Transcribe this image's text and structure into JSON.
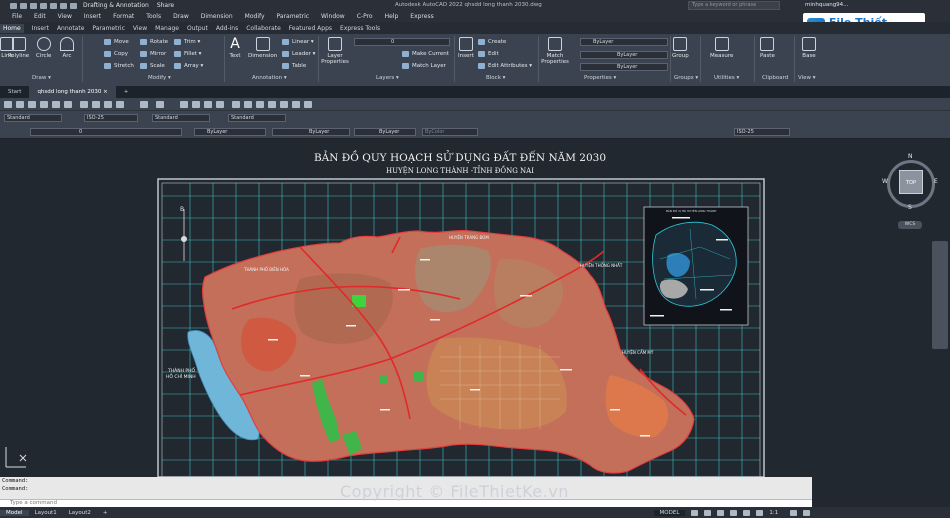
{
  "titlebar": {
    "workspace": "Drafting & Annotation",
    "share": "Share",
    "app_title": "Autodesk AutoCAD 2022    qhsdd long thanh 2030.dwg",
    "search_placeholder": "Type a keyword or phrase",
    "user": "minhquang94..."
  },
  "menu": [
    "File",
    "Edit",
    "View",
    "Insert",
    "Format",
    "Tools",
    "Draw",
    "Dimension",
    "Modify",
    "Parametric",
    "Window",
    "C-Pro",
    "Help",
    "Express"
  ],
  "ribbon_tabs": [
    "Home",
    "Insert",
    "Annotate",
    "Parametric",
    "View",
    "Manage",
    "Output",
    "Add-ins",
    "Collaborate",
    "Featured Apps",
    "Express Tools"
  ],
  "ribbon": {
    "draw": {
      "line": "Line",
      "polyline": "Polyline",
      "circle": "Circle",
      "arc": "Arc",
      "label": "Draw ▾"
    },
    "modify": {
      "move": "Move",
      "rotate": "Rotate",
      "trim": "Trim ▾",
      "copy": "Copy",
      "mirror": "Mirror",
      "fillet": "Fillet ▾",
      "stretch": "Stretch",
      "scale": "Scale",
      "array": "Array ▾",
      "label": "Modify ▾"
    },
    "annotation": {
      "text": "Text",
      "dimension": "Dimension",
      "linear": "Linear ▾",
      "leader": "Leader ▾",
      "table": "Table",
      "label": "Annotation ▾"
    },
    "layers": {
      "layer_properties": "Layer Properties",
      "current": "0",
      "make_current": "Make Current",
      "match_layer": "Match Layer",
      "label": "Layers ▾"
    },
    "block": {
      "insert": "Insert",
      "create": "Create",
      "edit": "Edit",
      "edit_attributes": "Edit Attributes ▾",
      "label": "Block ▾"
    },
    "properties": {
      "match": "Match Properties",
      "bylayer1": "ByLayer",
      "bylayer2": "ByLayer",
      "bylayer3": "ByLayer",
      "label": "Properties ▾"
    },
    "groups": {
      "group": "Group",
      "label": "Groups ▾"
    },
    "utilities": {
      "measure": "Measure",
      "label": "Utilities ▾"
    },
    "clipboard": {
      "paste": "Paste",
      "label": "Clipboard"
    },
    "view": {
      "base": "Base",
      "label": "View ▾"
    }
  },
  "file_tabs": {
    "start": "Start",
    "active": "qhsdd long thanh 2030",
    "close": "×",
    "add": "+"
  },
  "toolbars": {
    "style1": "Standard",
    "dimstyle": "ISO-25",
    "style2": "Standard",
    "style3": "Standard",
    "layer": "0",
    "color": "ByLayer",
    "linetype": "ByLayer",
    "lineweight": "ByLayer",
    "plotstyle": "ByColor",
    "dimstyle2": "ISO-25"
  },
  "map": {
    "title": "BẢN ĐỒ QUY HOẠCH SỬ DỤNG ĐẤT ĐẾN NĂM 2030",
    "subtitle": "HUYỆN LONG THÀNH -TỈNH ĐỒNG NAI",
    "label_bienhoa": "THÀNH PHỐ BIÊN HÒA",
    "label_trangbom": "HUYỆN TRẢNG BOM",
    "label_thongnhat": "HUYỆN THỐNG NHẤT",
    "label_cammy": "HUYỆN CẨM MỸ",
    "label_hcm1": "THÀNH PHỐ",
    "label_hcm2": "HỒ CHÍ MINH",
    "inset_title": "BẢN ĐỒ VỊ TRÍ HUYỆN LONG THÀNH"
  },
  "viewcube": {
    "n": "N",
    "s": "S",
    "e": "E",
    "w": "W",
    "face": "TOP",
    "wcs": "WCS"
  },
  "command": {
    "line1": "Command:",
    "line2": "Command:",
    "placeholder": "Type a command"
  },
  "status": {
    "model": "Model",
    "layout1": "Layout1",
    "layout2": "Layout2",
    "add": "+",
    "model_btn": "MODEL",
    "scale": "1:1"
  },
  "watermark": "Copyright © FileThietKe.vn",
  "logo": "File Thiết Kế.vn"
}
